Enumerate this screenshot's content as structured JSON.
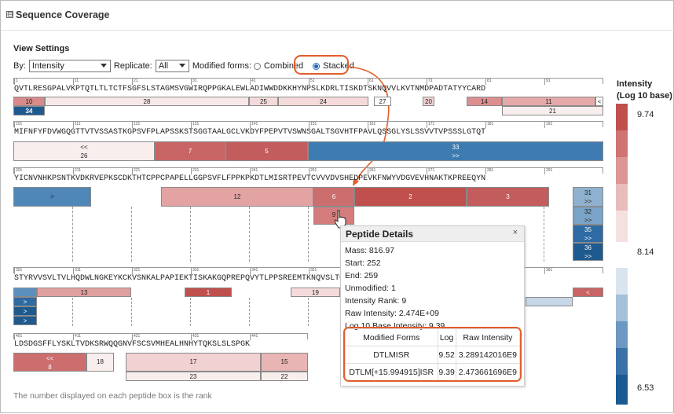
{
  "header": {
    "title": "Sequence Coverage",
    "toggle": "⊟"
  },
  "settings": {
    "title": "View Settings",
    "by_label": "By:",
    "by_value": "Intensity",
    "replicate_label": "Replicate:",
    "replicate_value": "All",
    "modified_label": "Modified forms:",
    "combined": "Combined",
    "stacked": "Stacked",
    "selected_mode": "Stacked"
  },
  "rows": [
    {
      "seq": "QVTLRESGPALVKPTQTLTLTCTFSGFSLSTAGMSVGWIRQPPGKALEWLADIWWDDKKHYNPSLKDRLTISKDTSKNQVVLKVTNMDPADTATYYCARD",
      "ticks": [
        "1",
        "11",
        "21",
        "31",
        "41",
        "51",
        "61",
        "71",
        "81",
        "91"
      ]
    },
    {
      "seq": "MIFNFYFDVWGQGTTVTVSSASTKGPSVFPLAPSSKSTSGGTAALGCLVKDYFPEPVTVSWNSGALTSGVHTFPAVLQSSGLYSLSSVVTVPSSSLGTQT",
      "ticks": [
        "101",
        "111",
        "121",
        "131",
        "141",
        "151",
        "161",
        "171",
        "181",
        "191"
      ]
    },
    {
      "seq": "YICNVNHKPSNTKVDKRVEPKSCDKTHTCPPCPAPELLGGPSVFLFPPKPKDTLMISRTPEVTCVVVDVSHEDPEVKFNWYVDGVEVHNAKTKPREEQYN",
      "ticks": [
        "201",
        "211",
        "221",
        "231",
        "241",
        "251",
        "261",
        "271",
        "281",
        "291"
      ]
    },
    {
      "seq": "STYRVVSVLTVLHQDWLNGKEYKCKVSNKALPAPIEKTISKAKGQPREPQVYTLPPSREEMTKNQVSLTCLVKGFYPSDIAVEWESNGQPENNYKTTPPV",
      "ticks": [
        "301",
        "311",
        "321",
        "331",
        "341",
        "351",
        "361",
        "371",
        "381",
        "391"
      ]
    },
    {
      "seq": "LDSDGSFFLYSKLTVDKSRWQQGNVFSCSVMHEALHNHYTQKSLSLSPGK",
      "ticks": [
        "401",
        "411",
        "421",
        "431",
        "441"
      ]
    }
  ],
  "peptides": [
    {
      "label": "10"
    },
    {
      "label": "28"
    },
    {
      "label": "25"
    },
    {
      "label": "24"
    },
    {
      "label": "27"
    },
    {
      "label": "20"
    },
    {
      "label": "14"
    },
    {
      "label": "11"
    },
    {
      "label": "<"
    },
    {
      "label": "34"
    },
    {
      "label": "21"
    },
    {
      "label": "<<"
    },
    {
      "label": "26"
    },
    {
      "label": "7"
    },
    {
      "label": "5"
    },
    {
      "label": "33"
    },
    {
      "label": ">>"
    },
    {
      "label": ">"
    },
    {
      "label": "12"
    },
    {
      "label": "6"
    },
    {
      "label": "2"
    },
    {
      "label": "3"
    },
    {
      "label": "31"
    },
    {
      "label": ">>"
    },
    {
      "label": "9"
    },
    {
      "label": "32"
    },
    {
      "label": ">>"
    },
    {
      "label": "35"
    },
    {
      "label": ">>"
    },
    {
      "label": "36"
    },
    {
      "label": ">>"
    },
    {
      "label": "13"
    },
    {
      "label": "1"
    },
    {
      "label": "19"
    },
    {
      "label": "<"
    },
    {
      "label": "<<"
    },
    {
      "label": "8"
    },
    {
      "label": "18"
    },
    {
      "label": "17"
    },
    {
      "label": "23"
    },
    {
      "label": "15"
    },
    {
      "label": "22"
    }
  ],
  "legend": {
    "title": "Intensity\n(Log 10 base)",
    "max": "9.74",
    "mid": "8.14",
    "min": "6.53"
  },
  "tooltip": {
    "title": "Peptide Details",
    "close": "×",
    "lines": [
      "Mass: 816.97",
      "Start: 252",
      "End: 259",
      "Unmodified: 1",
      "Intensity Rank: 9",
      "Raw Intensity: 2.474E+09",
      "Log 10 Base Intensity: 9.39"
    ],
    "table": {
      "headers": [
        "Modified Forms",
        "Log",
        "Raw Intensity"
      ],
      "rows": [
        [
          "DTLMISR",
          "9.52",
          "3.289142016E9"
        ],
        [
          "DTLM[+15.994915]ISR",
          "9.39",
          "2.473661696E9"
        ]
      ]
    }
  },
  "footer": "The number displayed on each peptide box is the rank",
  "colors": {
    "accent": "#e35d2b",
    "red_dark": "#c0504d",
    "blue_dark": "#1f5a8f"
  }
}
